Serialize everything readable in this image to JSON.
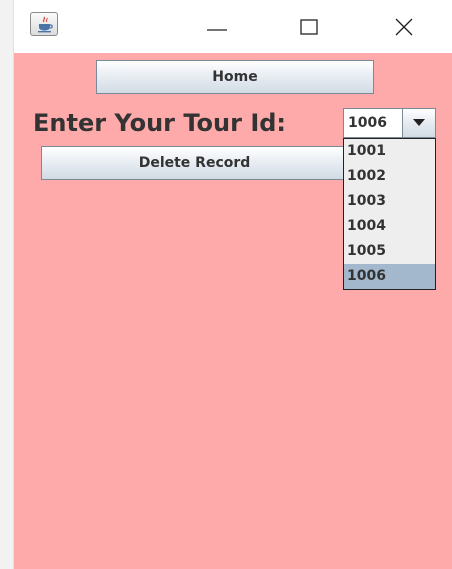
{
  "window": {
    "controls": {
      "app_icon": "java-icon",
      "minimize_icon": "minimize-icon",
      "maximize_icon": "maximize-icon",
      "close_icon": "close-icon"
    },
    "background_color": "#ffaaaa"
  },
  "form": {
    "home_button": "Home",
    "prompt": "Enter Your Tour Id:",
    "tour_id_select": {
      "selected": "1006",
      "options": [
        "1001",
        "1002",
        "1003",
        "1004",
        "1005",
        "1006"
      ],
      "highlight_color": "#a3b8cc",
      "arrow_icon": "chevron-down-icon"
    },
    "delete_button": "Delete Record"
  }
}
